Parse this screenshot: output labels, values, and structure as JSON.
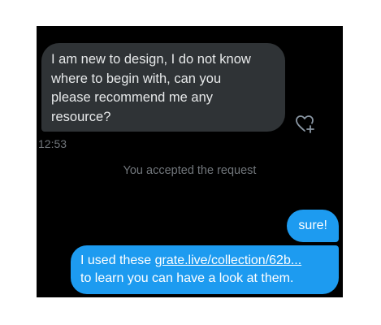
{
  "messages": {
    "incoming": {
      "lines": [
        "I am new to design, I do not know",
        "where to begin with, can you",
        "please recommend me any",
        "resource?"
      ],
      "timestamp": "12:53"
    },
    "system": "You accepted the request",
    "outgoing_short": "sure!",
    "outgoing_long": {
      "prefix": "I used these ",
      "link": "grate.live/collection/62b...",
      "line2": "to learn you can have a look at them."
    }
  },
  "colors": {
    "background": "#000000",
    "incoming_bubble": "#2f3336",
    "outgoing_bubble": "#1d9bf0",
    "muted_text": "#71767b"
  },
  "icons": {
    "react": "heart-plus-icon"
  }
}
